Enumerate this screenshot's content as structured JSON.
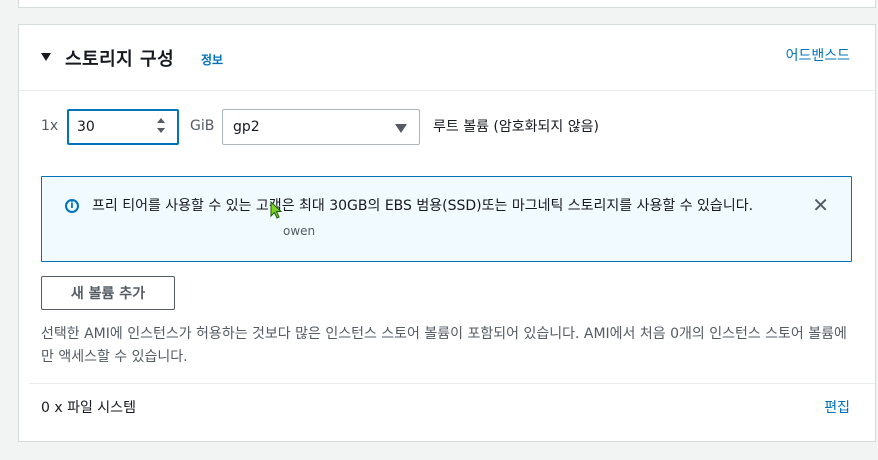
{
  "section": {
    "title": "스토리지 구성",
    "info_link": "정보",
    "advanced_link": "어드밴스드"
  },
  "volume": {
    "count_label": "1x",
    "size_value": "30",
    "size_unit": "GiB",
    "volume_type": "gp2",
    "root_label": "루트 볼륨  (암호화되지 않음)"
  },
  "alert": {
    "icon": "info-icon",
    "message": "프리 티어를 사용할 수 있는 고객은 최대 30GB의 EBS 범용(SSD)또는 마그네틱 스토리지를 사용할 수 있습니다.",
    "close_icon": "close-icon"
  },
  "cursor_label": "owen",
  "add_volume_button": "새 볼륨 추가",
  "description": "선택한 AMI에 인스턴스가 허용하는 것보다 많은 인스턴스 스토어 볼륨이 포함되어 있습니다. AMI에서 처음 0개의 인스턴스 스토어 볼륨에만 액세스할 수 있습니다.",
  "file_systems": {
    "label": "0 x 파일 시스템",
    "edit_link": "편집"
  },
  "colors": {
    "link": "#0073bb",
    "alert_bg": "#f1faff",
    "focus_border": "#0073bb"
  }
}
